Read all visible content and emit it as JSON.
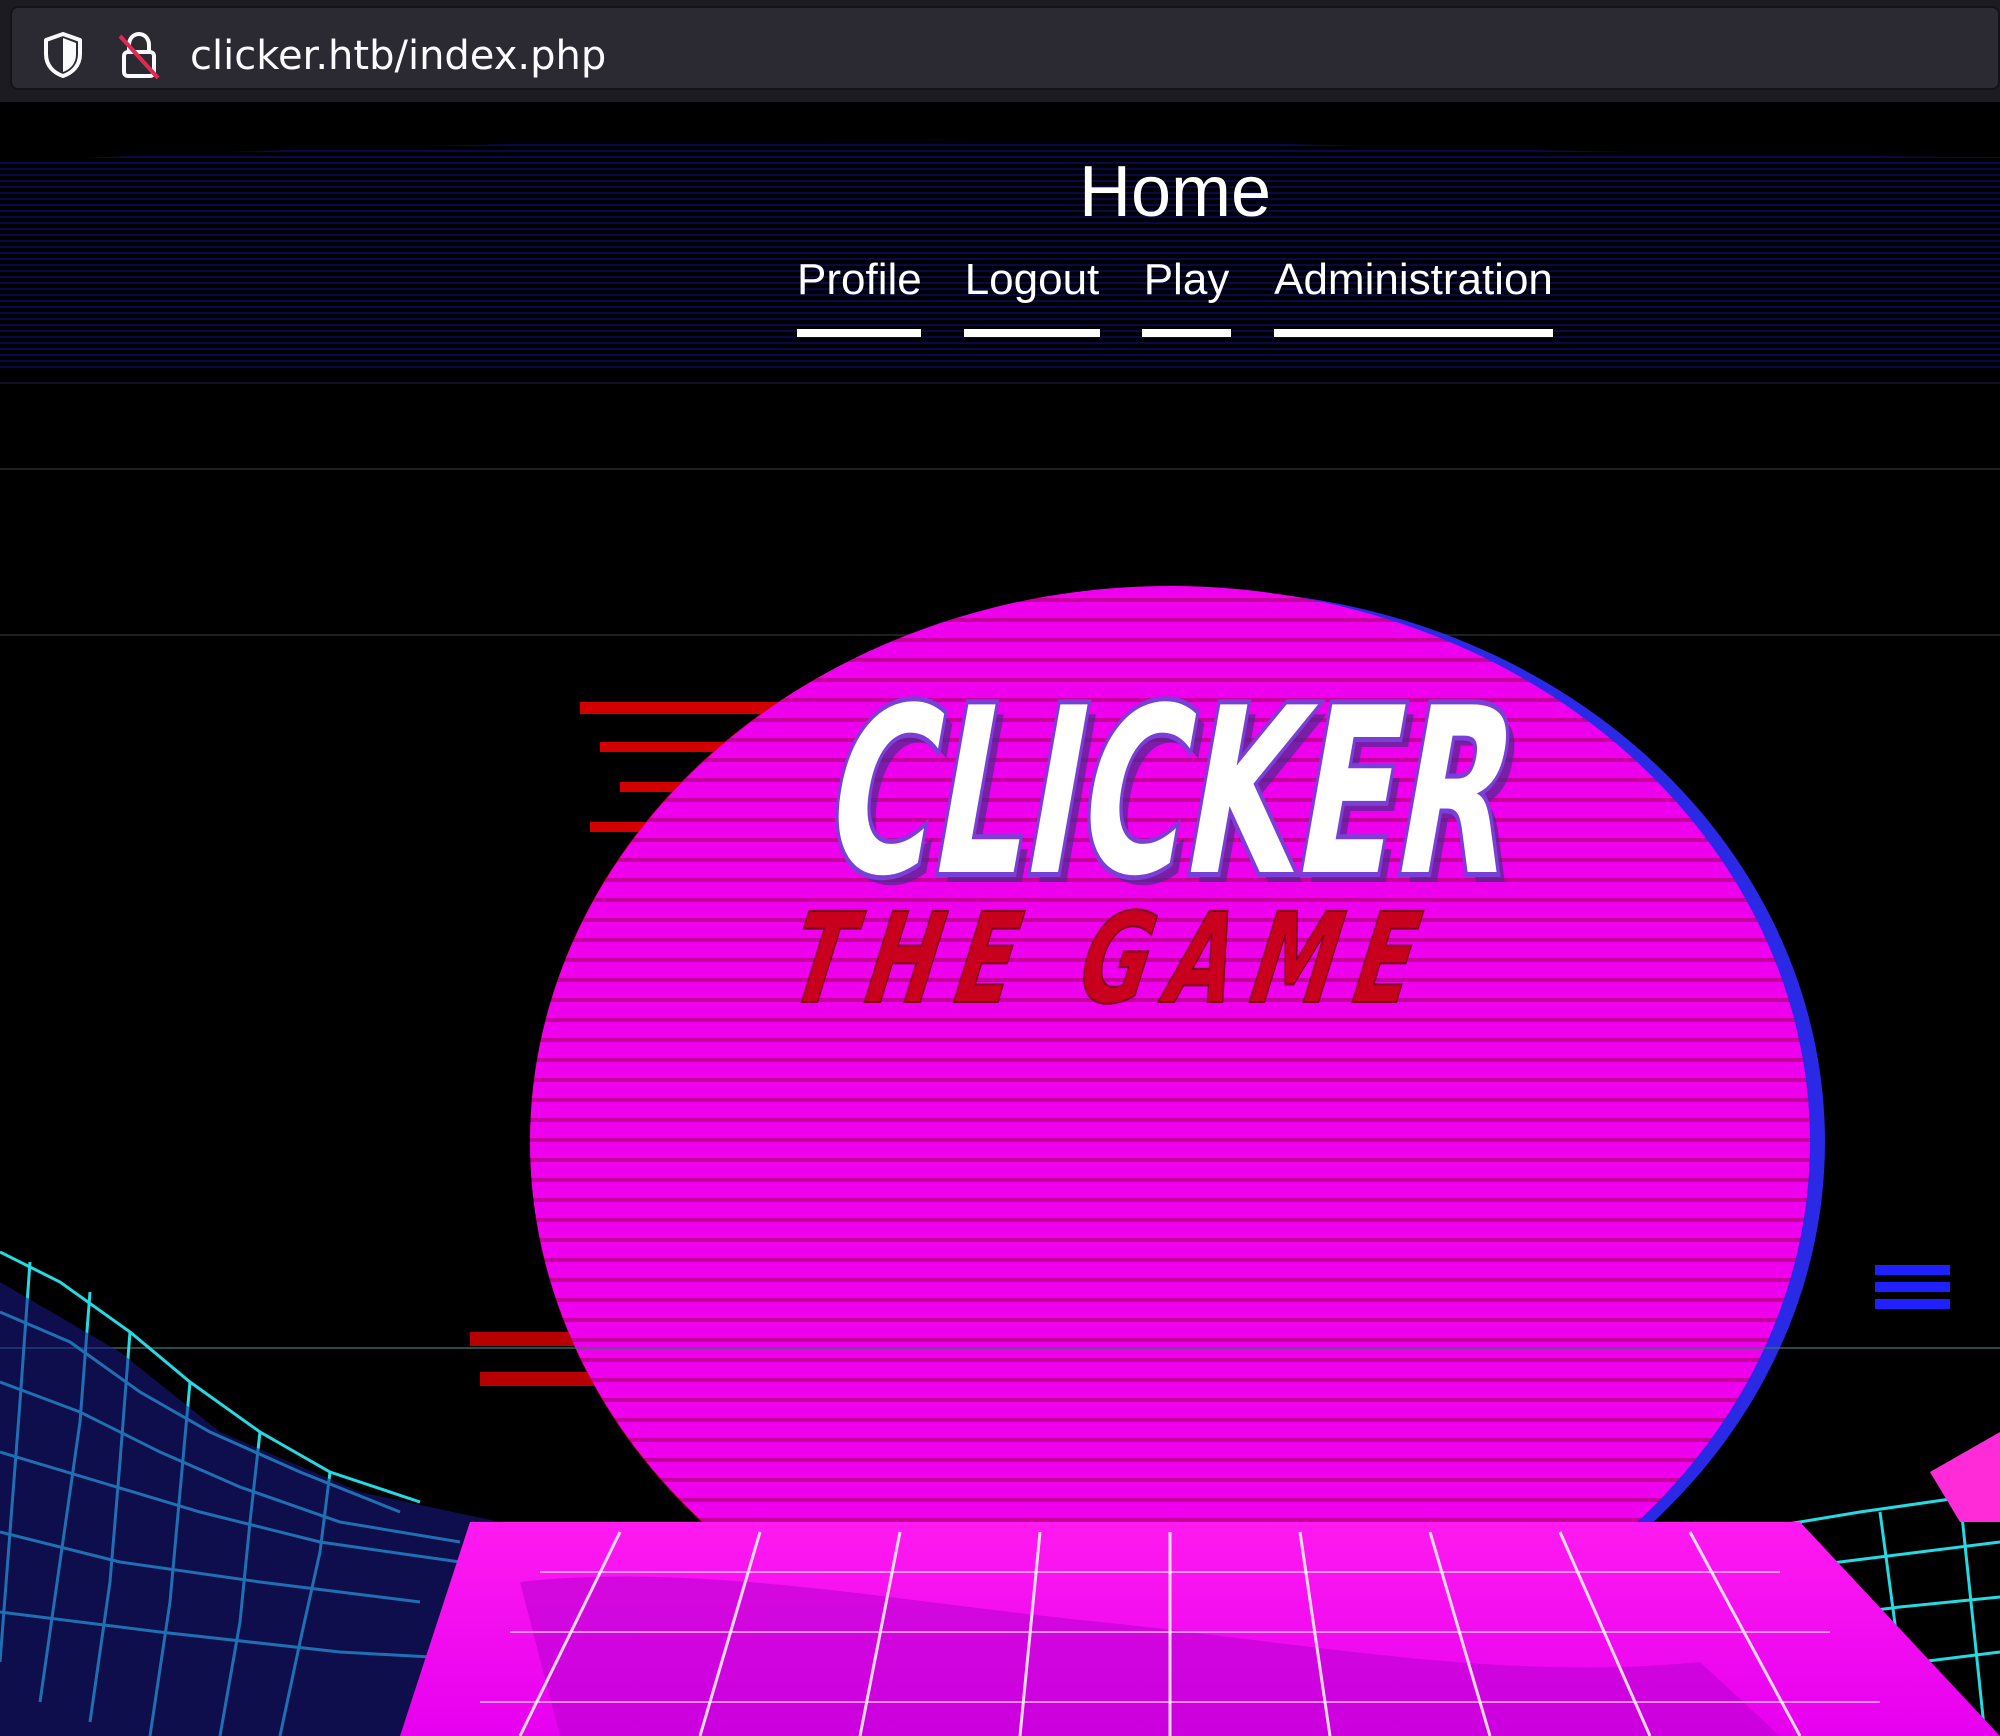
{
  "browser": {
    "url": "clicker.htb/index.php",
    "shield_icon": "shield-icon",
    "lock_icon": "insecure-lock-icon"
  },
  "page": {
    "title": "Home",
    "nav": [
      {
        "label": "Profile"
      },
      {
        "label": "Logout"
      },
      {
        "label": "Play"
      },
      {
        "label": "Administration"
      }
    ],
    "logo": {
      "line1": "CLICKER",
      "line2": "THE GAME"
    }
  },
  "colors": {
    "sun": "#ee00ee",
    "grid": "#29e6f0",
    "glitch_red": "#d40000",
    "glitch_blue": "#1a1aff",
    "logo_outline": "#7a3fd6",
    "logo_subtitle": "#c8001e"
  }
}
